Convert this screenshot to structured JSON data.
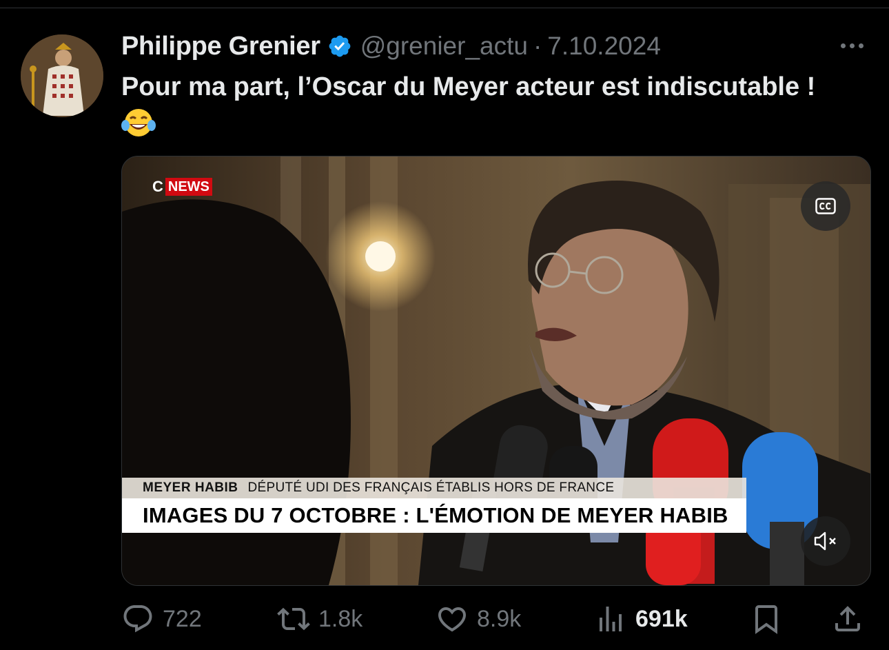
{
  "tweet": {
    "author_name": "Philippe Grenier",
    "handle": "@grenier_actu",
    "separator": "·",
    "date": "7.10.2024",
    "text": "Pour ma part, l’Oscar du Meyer acteur est indiscutable ! "
  },
  "media": {
    "channel_logo_c": "C",
    "channel_logo_news": "NEWS",
    "lower_third_name": "MEYER HABIB",
    "lower_third_role": "DÉPUTÉ UDI DES FRANÇAIS ÉTABLIS HORS DE FRANCE",
    "lower_third_title": "IMAGES DU 7 OCTOBRE : L'ÉMOTION DE MEYER HABIB",
    "cc_icon": "closed-captions-icon",
    "mute_icon": "speaker-muted-icon"
  },
  "actions": {
    "replies": "722",
    "reposts": "1.8k",
    "likes": "8.9k",
    "views": "691k"
  },
  "colors": {
    "background": "#000000",
    "text": "#e7e9ea",
    "muted": "#71767b",
    "verified": "#1d9bf0",
    "cnews_red": "#d10a11"
  }
}
